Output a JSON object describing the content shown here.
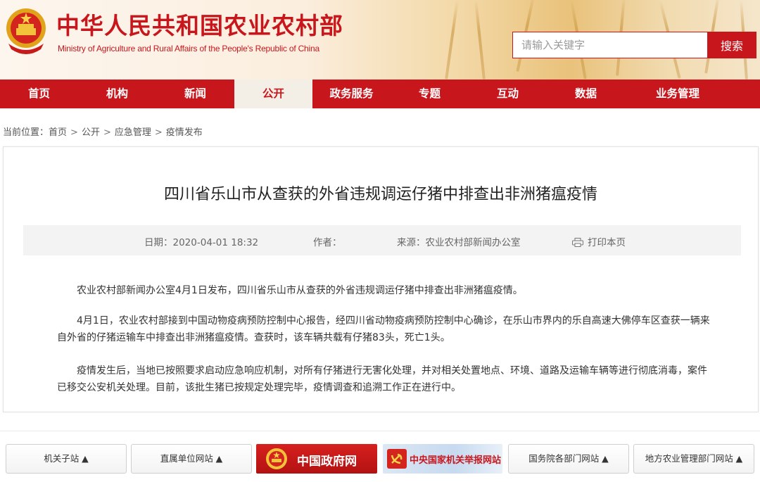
{
  "header": {
    "site_title": "中华人民共和国农业农村部",
    "site_subtitle": "Ministry of Agriculture and Rural Affairs of the People's Republic of China",
    "search_placeholder": "请输入关键字",
    "search_button": "搜索"
  },
  "nav": {
    "items": [
      {
        "label": "首页"
      },
      {
        "label": "机构"
      },
      {
        "label": "新闻"
      },
      {
        "label": "公开",
        "active": true
      },
      {
        "label": "政务服务"
      },
      {
        "label": "专题"
      },
      {
        "label": "互动"
      },
      {
        "label": "数据"
      },
      {
        "label": "业务管理"
      }
    ]
  },
  "breadcrumb": {
    "prefix": "当前位置：",
    "items": [
      "首页",
      "公开",
      "应急管理",
      "疫情发布"
    ],
    "separator": ">"
  },
  "article": {
    "title": "四川省乐山市从查获的外省违规调运仔猪中排查出非洲猪瘟疫情",
    "date": "日期：2020-04-01 18:32",
    "author": "作者：",
    "source": "来源：农业农村部新闻办公室",
    "print": "打印本页",
    "paragraphs": [
      "农业农村部新闻办公室4月1日发布，四川省乐山市从查获的外省违规调运仔猪中排查出非洲猪瘟疫情。",
      "4月1日，农业农村部接到中国动物疫病预防控制中心报告，经四川省动物疫病预防控制中心确诊，在乐山市界内的乐自高速大佛停车区查获一辆来自外省的仔猪运输车中排查出非洲猪瘟疫情。查获时，该车辆共载有仔猪83头，死亡1头。",
      "疫情发生后，当地已按照要求启动应急响应机制，对所有仔猪进行无害化处理，并对相关处置地点、环境、道路及运输车辆等进行彻底消毒，案件已移交公安机关处理。目前，该批生猪已按规定处理完毕，疫情调查和追溯工作正在进行中。"
    ]
  },
  "footer": {
    "buttons": [
      "机关子站 ▲",
      "直属单位网站 ▲",
      "国务院各部门网站 ▲",
      "地方农业管理部门网站 ▲"
    ],
    "gov_banner": "中国政府网",
    "report_banner": "中央国家机关举报网站"
  },
  "colors": {
    "brand_red": "#c8161d",
    "nav_active_bg": "#f4efe6"
  }
}
